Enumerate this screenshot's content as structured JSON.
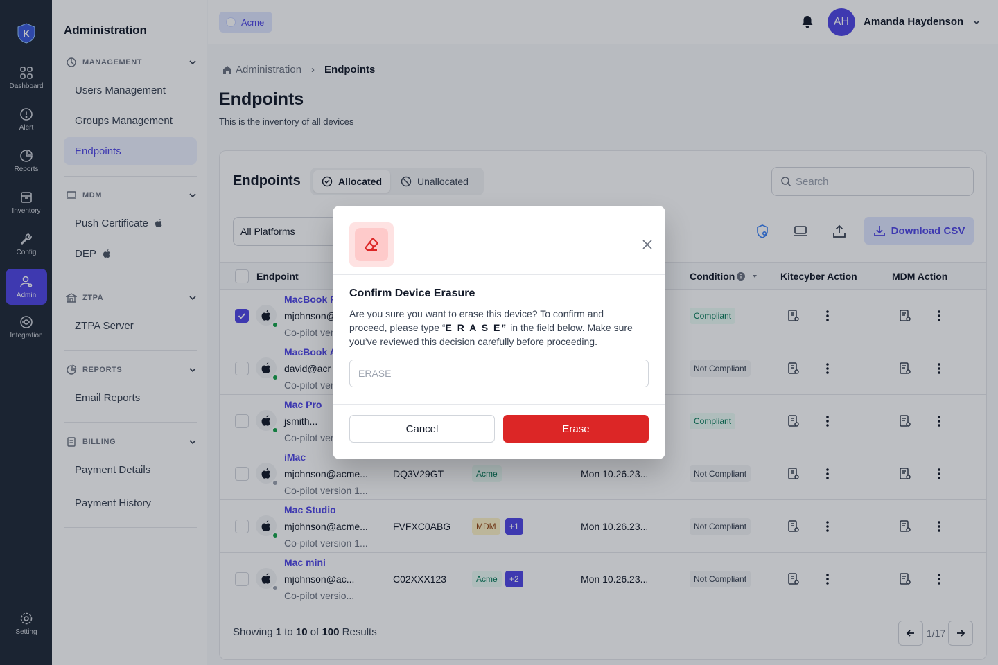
{
  "rail": {
    "items": [
      {
        "label": "Dashboard",
        "icon": "grid-icon"
      },
      {
        "label": "Alert",
        "icon": "alert-icon"
      },
      {
        "label": "Reports",
        "icon": "pie-chart-icon"
      },
      {
        "label": "Inventory",
        "icon": "archive-icon"
      },
      {
        "label": "Config",
        "icon": "wrench-icon"
      },
      {
        "label": "Admin",
        "icon": "admin-user-icon"
      },
      {
        "label": "Integration",
        "icon": "integration-icon"
      }
    ],
    "setting": "Setting"
  },
  "sidebar": {
    "title": "Administration",
    "sections": [
      {
        "label": "MANAGEMENT",
        "items": [
          "Users Management",
          "Groups Management",
          "Endpoints"
        ]
      },
      {
        "label": "MDM",
        "items": [
          "Push Certificate",
          "DEP"
        ]
      },
      {
        "label": "ZTPA",
        "items": [
          "ZTPA Server"
        ]
      },
      {
        "label": "REPORTS",
        "items": [
          "Email Reports"
        ]
      },
      {
        "label": "BILLING",
        "items": [
          "Payment Details",
          "Payment History"
        ]
      }
    ],
    "active": "Endpoints"
  },
  "topbar": {
    "tenant": "Acme",
    "avatar_initials": "AH",
    "user_name": "Amanda Haydenson"
  },
  "breadcrumb": {
    "root": "Administration",
    "current": "Endpoints"
  },
  "page": {
    "title": "Endpoints",
    "subtitle": "This is the inventory of all devices"
  },
  "card": {
    "title": "Endpoints",
    "tabs": {
      "allocated": "Allocated",
      "unallocated": "Unallocated"
    },
    "search_placeholder": "Search",
    "platform_select": "All Platforms",
    "download_label": "Download CSV"
  },
  "table": {
    "columns": {
      "endpoint": "Endpoint",
      "condition": "Condition",
      "kitecyber_action": "Kitecyber Action",
      "mdm_action": "MDM Action"
    },
    "rows": [
      {
        "name": "MacBook P",
        "email": "mjohnson@ac",
        "copilot": "Co-pilot ver",
        "serial": "",
        "tags": [],
        "date": "",
        "condition": "Compliant",
        "online": true,
        "checked": true
      },
      {
        "name": "MacBook A",
        "email": "david@acr",
        "copilot": "Co-pilot ver",
        "serial": "",
        "tags": [],
        "date": "",
        "condition": "Not Compliant",
        "online": true,
        "checked": false
      },
      {
        "name": "Mac Pro",
        "email": "jsmith...",
        "copilot": "Co-pilot ver",
        "serial": "",
        "tags": [],
        "date": "",
        "condition": "Compliant",
        "online": true,
        "checked": false
      },
      {
        "name": "iMac",
        "email": "mjohnson@acme...",
        "copilot": "Co-pilot version 1...",
        "serial": "DQ3V29GT",
        "tags": [
          "Acme"
        ],
        "date": "Mon 10.26.23...",
        "condition": "Not Compliant",
        "online": false,
        "checked": false
      },
      {
        "name": "Mac Studio",
        "email": "mjohnson@acme...",
        "copilot": "Co-pilot version 1...",
        "serial": "FVFXC0ABG",
        "tags": [
          "MDM",
          "+1"
        ],
        "date": "Mon 10.26.23...",
        "condition": "Not Compliant",
        "online": true,
        "checked": false
      },
      {
        "name": "Mac mini",
        "email": "mjohnson@ac...",
        "copilot": "Co-pilot versio...",
        "serial": "C02XXX123",
        "tags": [
          "Acme",
          "+2"
        ],
        "date": "Mon 10.26.23...",
        "condition": "Not Compliant",
        "online": false,
        "checked": false
      }
    ]
  },
  "footer": {
    "showing": "Showing",
    "from": "1",
    "to_word": "to",
    "to": "10",
    "of_word": "of",
    "total": "100",
    "results": "Results",
    "page": "1/17"
  },
  "modal": {
    "title": "Confirm Device Erasure",
    "body_before": "Are you sure you want to erase this device? To confirm and proceed, please type “",
    "keyword": "E R A S E”",
    "body_after": " in the field below. Make sure you’ve reviewed this decision carefully before proceeding.",
    "input_placeholder": "ERASE",
    "cancel": "Cancel",
    "confirm": "Erase"
  },
  "colors": {
    "accent": "#4f46e5",
    "danger": "#dc2626",
    "success": "#16a34a"
  }
}
